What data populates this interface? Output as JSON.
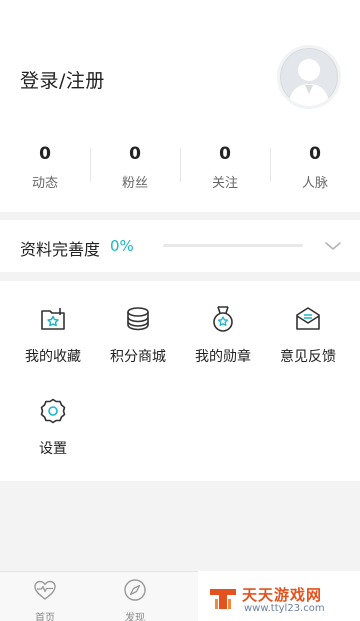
{
  "profile": {
    "login_label": "登录/注册",
    "avatar_icon": "default-avatar-icon"
  },
  "stats": [
    {
      "value": "0",
      "label": "动态"
    },
    {
      "value": "0",
      "label": "粉丝"
    },
    {
      "value": "0",
      "label": "关注"
    },
    {
      "value": "0",
      "label": "人脉"
    }
  ],
  "completeness": {
    "label": "资料完善度",
    "percent_text": "0%",
    "progress": 0,
    "expand_icon": "chevron-down-icon"
  },
  "menu": [
    {
      "label": "我的收藏",
      "icon": "folder-star-icon"
    },
    {
      "label": "积分商城",
      "icon": "coin-stack-icon"
    },
    {
      "label": "我的勋章",
      "icon": "medal-icon"
    },
    {
      "label": "意见反馈",
      "icon": "envelope-icon"
    },
    {
      "label": "设置",
      "icon": "gear-icon"
    }
  ],
  "tabbar": [
    {
      "label": "首页",
      "icon": "heart-pulse-icon"
    },
    {
      "label": "发现",
      "icon": "compass-icon"
    }
  ],
  "watermark": {
    "title": "天天游戏网",
    "url": "www.ttyl23.com"
  },
  "colors": {
    "accent": "#1cb5c8",
    "text": "#222222",
    "muted": "#666666",
    "background": "#f3f3f3"
  }
}
